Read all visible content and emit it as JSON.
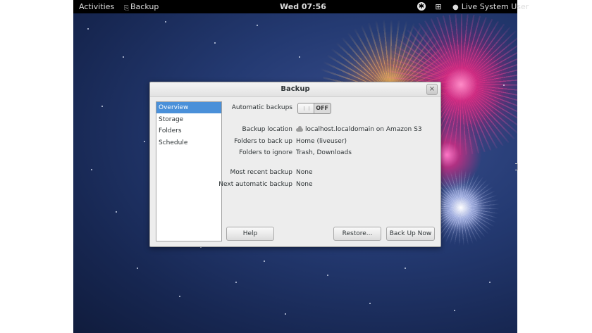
{
  "topbar": {
    "activities": "Activities",
    "app_name": "Backup",
    "clock": "Wed 07:56",
    "user": "Live System User",
    "icons": [
      "accessibility-icon",
      "network-icon",
      "user-icon"
    ]
  },
  "dialog": {
    "title": "Backup",
    "sidebar": {
      "items": [
        {
          "label": "Overview",
          "selected": true
        },
        {
          "label": "Storage",
          "selected": false
        },
        {
          "label": "Folders",
          "selected": false
        },
        {
          "label": "Schedule",
          "selected": false
        }
      ]
    },
    "overview": {
      "automatic_backups_label": "Automatic backups",
      "automatic_backups_state": "OFF",
      "backup_location_label": "Backup location",
      "backup_location_value": "localhost.localdomain on Amazon S3",
      "folders_to_back_up_label": "Folders to back up",
      "folders_to_back_up_value": "Home (liveuser)",
      "folders_to_ignore_label": "Folders to ignore",
      "folders_to_ignore_value": "Trash, Downloads",
      "most_recent_backup_label": "Most recent backup",
      "most_recent_backup_value": "None",
      "next_automatic_backup_label": "Next automatic backup",
      "next_automatic_backup_value": "None"
    },
    "buttons": {
      "help": "Help",
      "restore": "Restore...",
      "back_up_now": "Back Up Now"
    }
  },
  "colors": {
    "selection": "#4a90d9",
    "desktop": "#1c2c5c",
    "firework_pink": "#e02882"
  }
}
